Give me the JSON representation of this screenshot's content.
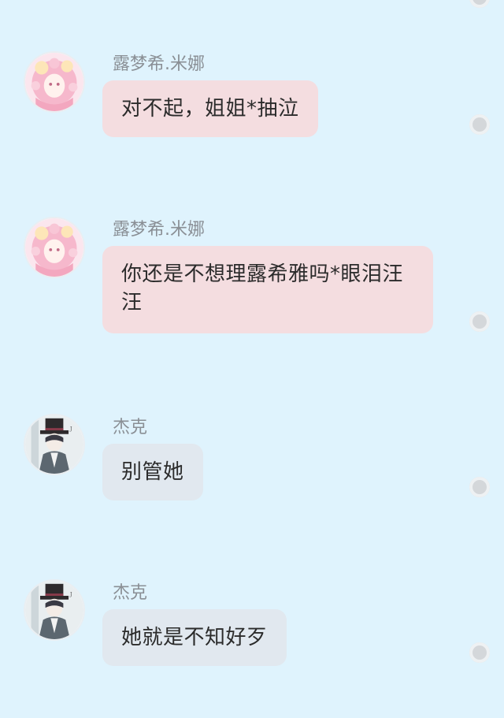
{
  "messages": [
    {
      "sender": "露梦希.米娜",
      "text": "对不起，姐姐*抽泣",
      "avatar_icon": "pink-hair-girl-avatar",
      "bubble_color": "#f4dde0"
    },
    {
      "sender": "露梦希.米娜",
      "text": "你还是不想理露希雅吗*眼泪汪汪",
      "avatar_icon": "pink-hair-girl-avatar",
      "bubble_color": "#f4dde0"
    },
    {
      "sender": "杰克",
      "text": "别管她",
      "avatar_icon": "top-hat-boy-avatar",
      "bubble_color": "#e1e8ef"
    },
    {
      "sender": "杰克",
      "text": "她就是不知好歹",
      "avatar_icon": "top-hat-boy-avatar",
      "bubble_color": "#e1e8ef"
    }
  ],
  "colors": {
    "background": "#dff3fd",
    "name_text": "#8a8f95"
  }
}
